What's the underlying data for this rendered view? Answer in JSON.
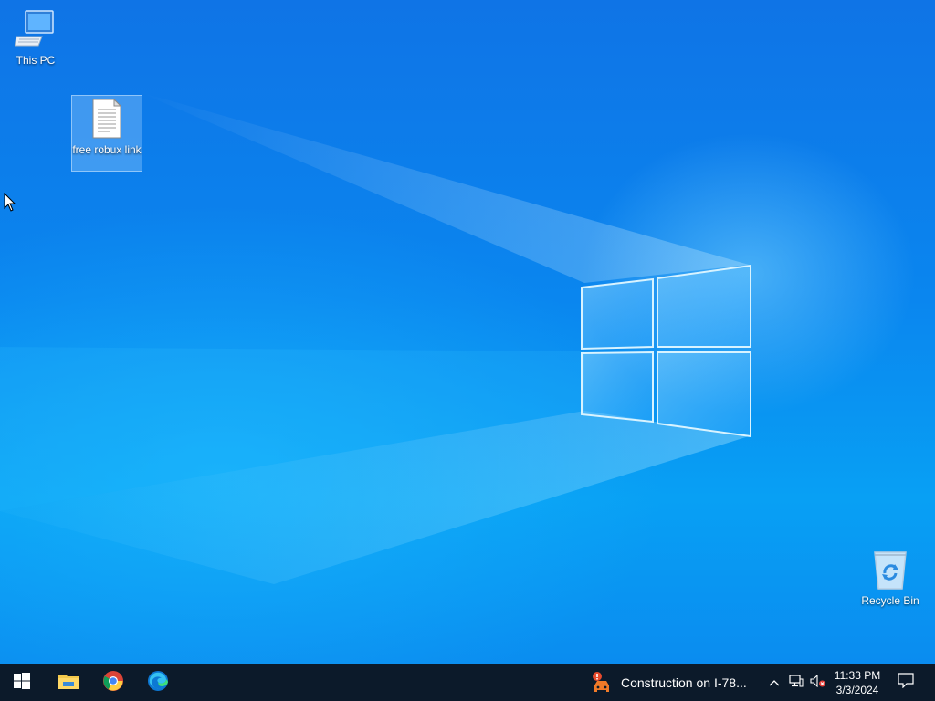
{
  "desktop": {
    "icons": [
      {
        "label": "This PC",
        "icon": "computer-icon"
      },
      {
        "label": "free robux link",
        "icon": "text-document-icon",
        "selected": true
      },
      {
        "label": "Recycle Bin",
        "icon": "recycle-bin-icon"
      }
    ],
    "wallpaper": "windows-10-hero-blue",
    "colors": {
      "wallpaper_primary": "#0a86ef",
      "taskbar": "#0c1a2a"
    }
  },
  "taskbar": {
    "start_icon": "windows-start-icon",
    "pinned": [
      {
        "name": "File Explorer",
        "icon": "file-explorer-icon"
      },
      {
        "name": "Google Chrome",
        "icon": "chrome-icon"
      },
      {
        "name": "Microsoft Edge",
        "icon": "edge-icon"
      }
    ],
    "news": {
      "text": "Construction on I-78...",
      "icon": "traffic-alert-icon"
    },
    "tray": {
      "chevron_icon": "chevron-up-icon",
      "network_icon": "network-icon",
      "volume_icon": "volume-muted-icon"
    },
    "clock": {
      "time": "11:33 PM",
      "date": "3/3/2024"
    },
    "notifications_icon": "action-center-icon"
  }
}
